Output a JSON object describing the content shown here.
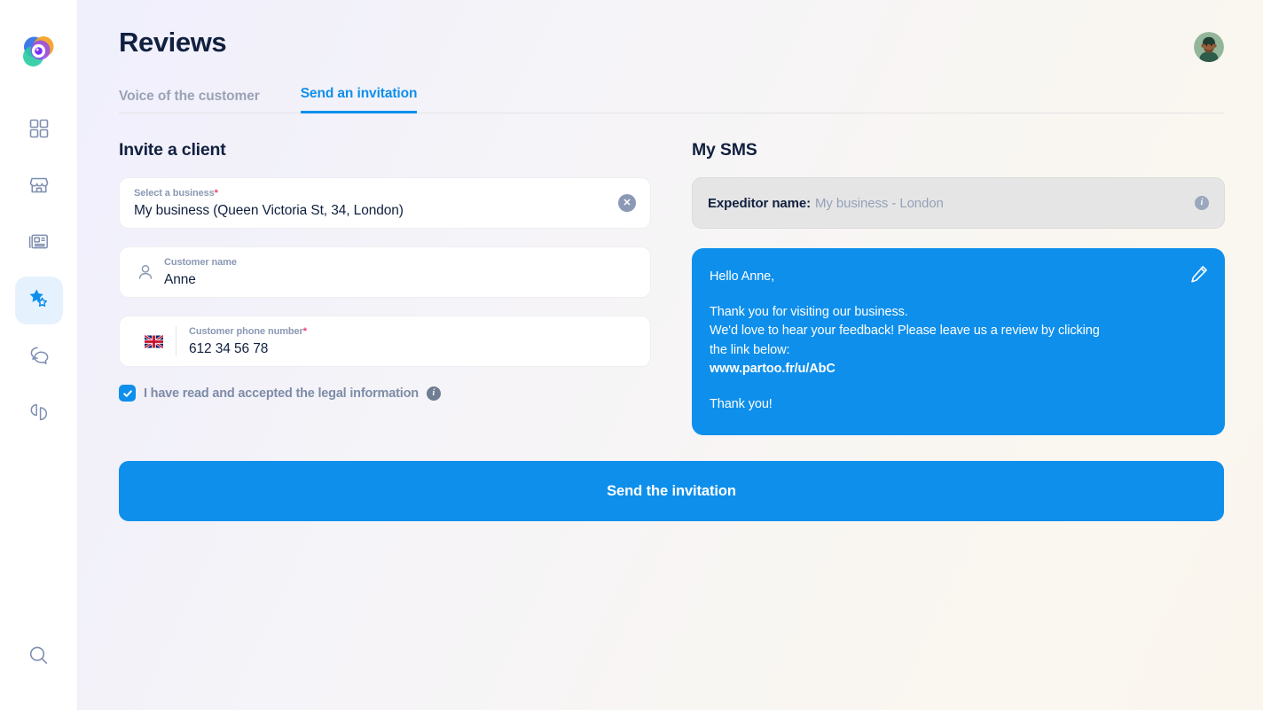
{
  "sidebar": {
    "logo_name": "partoo-logo",
    "items": [
      {
        "id": "dashboard",
        "icon": "grid-dashboard-icon",
        "active": false
      },
      {
        "id": "businesses",
        "icon": "storefront-icon",
        "active": false
      },
      {
        "id": "posts",
        "icon": "newspaper-icon",
        "active": false
      },
      {
        "id": "reviews",
        "icon": "star-review-icon",
        "active": true
      },
      {
        "id": "messages",
        "icon": "chat-bubbles-icon",
        "active": false
      },
      {
        "id": "analytics",
        "icon": "pie-chart-icon",
        "active": false
      }
    ],
    "search_icon": "search-icon"
  },
  "header": {
    "title": "Reviews",
    "avatar_name": "user-avatar"
  },
  "tabs": [
    {
      "label": "Voice of the customer",
      "active": false
    },
    {
      "label": "Send an invitation",
      "active": true
    }
  ],
  "invite": {
    "section_title": "Invite a client",
    "business_field": {
      "label": "Select a business",
      "required_marker": "*",
      "value": "My business (Queen Victoria St, 34, London)",
      "clear_glyph": "✕"
    },
    "name_field": {
      "label": "Customer name",
      "required_marker": "",
      "value": "Anne",
      "placeholder": "Customer name"
    },
    "phone_field": {
      "label": "Customer phone number",
      "required_marker": "*",
      "value": "612 34 56 78",
      "placeholder": "612 34 56 78",
      "country_flag": "uk-flag-icon"
    },
    "legal": {
      "text": "I have read and accepted the legal information",
      "checked": true,
      "info_glyph": "i"
    },
    "submit_label": "Send the invitation"
  },
  "sms": {
    "section_title": "My SMS",
    "expeditor_label": "Expeditor name:",
    "expeditor_value": "My business - London",
    "info_glyph": "i",
    "edit_icon": "pencil-edit-icon",
    "lines": [
      {
        "text": "Hello Anne,",
        "bold": false
      },
      {
        "text": "",
        "bold": false
      },
      {
        "text": "Thank you for visiting our business.",
        "bold": false
      },
      {
        "text": "We'd love to hear your feedback! Please leave us a review by clicking",
        "bold": false
      },
      {
        "text": "the link below:",
        "bold": false
      },
      {
        "text": "www.partoo.fr/u/AbC",
        "bold": true
      },
      {
        "text": "",
        "bold": false
      },
      {
        "text": "Thank you!",
        "bold": false
      }
    ]
  },
  "colors": {
    "accent": "#0e8fec",
    "title": "#11203f",
    "muted": "#8b99b5",
    "required": "#f0436d",
    "active_nav_bg": "#e5f2fe"
  }
}
